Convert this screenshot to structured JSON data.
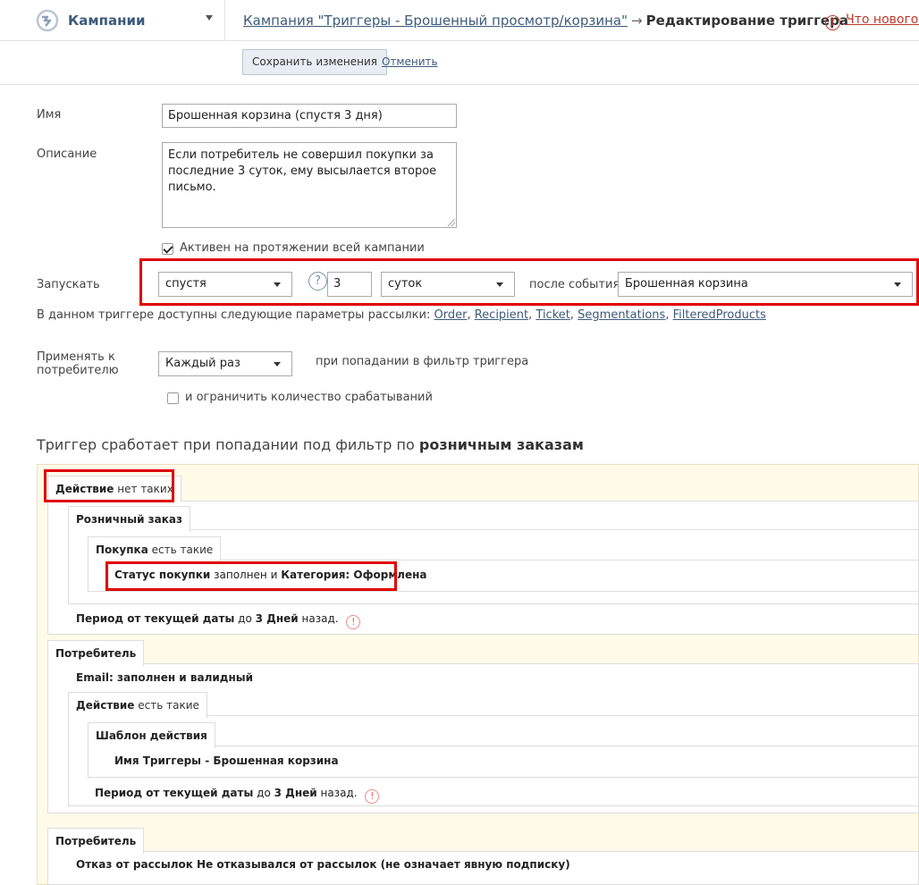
{
  "header": {
    "app_title": "Кампании",
    "breadcrumb_link": "Кампания \"Триггеры - Брошенный просмотр/корзина\"",
    "breadcrumb_arrow": "→",
    "breadcrumb_current": "Редактирование триггера",
    "whats_new_icon": "!",
    "whats_new": "Что нового?"
  },
  "toolbar": {
    "save_label": "Сохранить изменения",
    "cancel_label": "Отменить"
  },
  "form": {
    "name_label": "Имя",
    "name_value": "Брошенная корзина (спустя 3 дня)",
    "description_label": "Описание",
    "description_value": "Если потребитель не совершил покупки за последние 3 суток, ему высылается второе письмо.",
    "active_checkbox_label": "Активен на протяжении всей кампании",
    "active_checked": true,
    "launch_label": "Запускать",
    "launch_mode": "спустя",
    "help_icon": "?",
    "launch_amount": "3",
    "launch_unit": "суток",
    "after_event_label": "после события",
    "event_value": "Брошенная корзина",
    "params_text": "В данном триггере доступны следующие параметры рассылки:",
    "params": [
      "Order",
      "Recipient",
      "Ticket",
      "Segmentations",
      "FilteredProducts"
    ],
    "params_separator": ",",
    "apply_label_line1": "Применять к",
    "apply_label_line2": "потребителю",
    "apply_value": "Каждый раз",
    "apply_suffix": "при попадании в фильтр триггера",
    "limit_checkbox_label": "и ограничить количество срабатываний",
    "limit_checked": false
  },
  "filter": {
    "title_prefix": "Триггер сработает при попадании под фильтр по",
    "title_bold": "розничным заказам",
    "action_tab_bold": "Действие",
    "action_tab_rest": "нет таких",
    "retail_order_tab": "Розничный заказ",
    "purchase_tab_bold": "Покупка",
    "purchase_tab_rest": "есть такие",
    "status_bold": "Статус покупки",
    "status_mid": "заполнен и",
    "status_bold2": "Категория: Оформлена",
    "period1_bold": "Период от текущей даты",
    "period1_mid": "до",
    "period1_bold2": "3 Дней",
    "period1_rest": "назад.",
    "warn_icon": "!",
    "consumer_tab": "Потребитель",
    "email_text": "Email: заполнен и валидный",
    "action2_tab_bold": "Действие",
    "action2_tab_rest": "есть такие",
    "template_tab": "Шаблон действия",
    "template_text": "Имя Триггеры - Брошенная корзина",
    "period2_bold": "Период от текущей даты",
    "period2_mid": "до",
    "period2_bold2": "3 Дней",
    "period2_rest": "назад.",
    "consumer2_tab": "Потребитель",
    "unsub_text": "Отказ от рассылок Не отказывался от рассылок (не означает явную подписку)"
  },
  "colors": {
    "link": "#3d5a7a",
    "highlight": "#e00000",
    "filter_bg": "#fffbe8"
  }
}
